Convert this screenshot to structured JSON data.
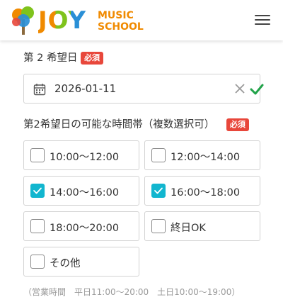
{
  "header": {
    "logo_word": "JOY",
    "logo_line1": "MUSIC",
    "logo_line2": "SCHOOL",
    "menu_icon": "hamburger-menu-icon"
  },
  "colors": {
    "logo_orange": "#f08a00",
    "logo_green": "#7fc31c",
    "logo_blue": "#2a8fd6",
    "required_red": "#e8473b",
    "check_cyan": "#12b6cf",
    "valid_green": "#22a34a"
  },
  "second_choice_date": {
    "label": "第 2 希望日",
    "required_badge": "必須",
    "value": "2026-01-11",
    "icons": [
      "calendar-icon",
      "clear-x-icon",
      "valid-check-icon"
    ]
  },
  "time_slots": {
    "label": "第2希望日の可能な時間帯（複数選択可）",
    "required_badge": "必須",
    "options": [
      {
        "label": "10:00～12:00",
        "checked": false
      },
      {
        "label": "12:00～14:00",
        "checked": false
      },
      {
        "label": "14:00～16:00",
        "checked": true
      },
      {
        "label": "16:00～18:00",
        "checked": true
      },
      {
        "label": "18:00～20:00",
        "checked": false
      },
      {
        "label": "終日OK",
        "checked": false
      },
      {
        "label": "その他",
        "checked": false
      }
    ]
  },
  "business_hours_note": "（営業時間　平日11:00～20:00　土日10:00～19:00）"
}
